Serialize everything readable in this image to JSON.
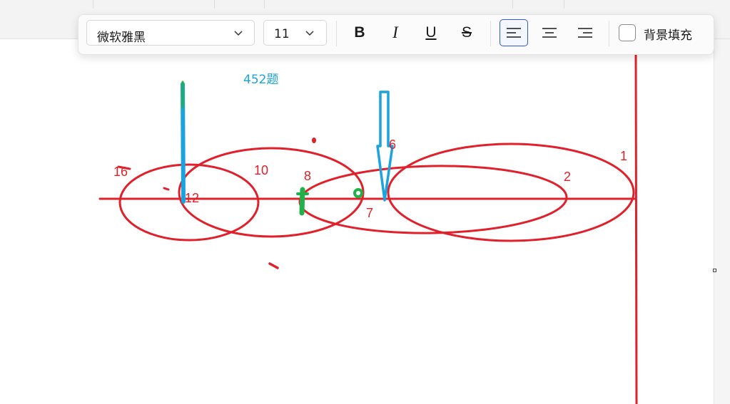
{
  "toolbar": {
    "font_family_value": "微软雅黑",
    "font_size_value": "11",
    "bold_glyph": "B",
    "italic_glyph": "I",
    "underline_glyph": "U",
    "strike_glyph": "S",
    "background_fill_label": "背景填充",
    "background_fill_checked": false,
    "align_active": "left"
  },
  "canvas": {
    "title_note": "452题",
    "labels": {
      "one": "1",
      "two": "2",
      "six": "6",
      "seven": "7",
      "eight": "8",
      "ten": "10",
      "twelve": "12",
      "sixteen": "16"
    },
    "colors": {
      "ink_red": "#e0202a",
      "arrow_blue": "#1aa3dc",
      "mark_green": "#22b04a",
      "note_blue": "#1aa3dc",
      "accent_active": "#2d5bd6"
    }
  }
}
